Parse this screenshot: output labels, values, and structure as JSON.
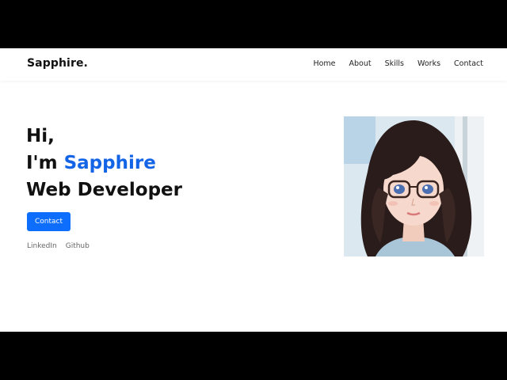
{
  "brand": {
    "name": "Sapphire."
  },
  "nav": {
    "items": [
      {
        "label": "Home"
      },
      {
        "label": "About"
      },
      {
        "label": "Skills"
      },
      {
        "label": "Works"
      },
      {
        "label": "Contact"
      }
    ]
  },
  "hero": {
    "greeting": "Hi,",
    "intro_prefix": "I'm",
    "name": "Sapphire",
    "role": "Web Developer",
    "cta_label": "Contact",
    "social": [
      {
        "label": "LinkedIn"
      },
      {
        "label": "Github"
      }
    ],
    "accent_color": "#1464e6",
    "button_color": "#0d6efd"
  },
  "portrait": {
    "icon": "portrait-image"
  }
}
